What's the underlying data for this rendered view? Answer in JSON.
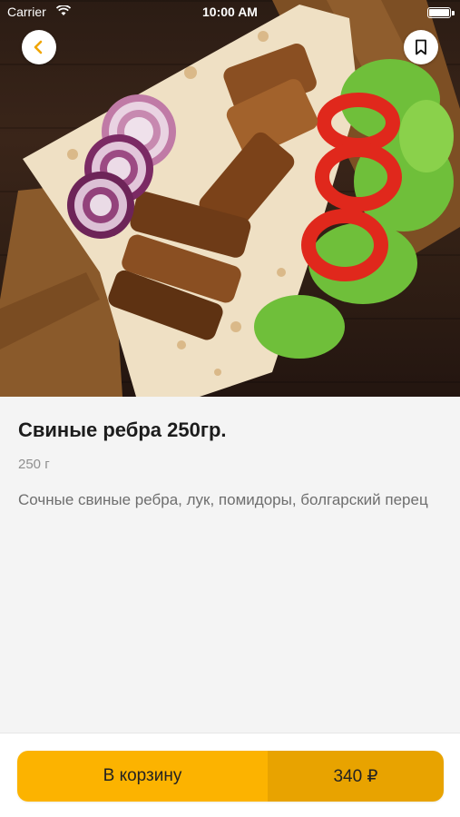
{
  "status_bar": {
    "carrier": "Carrier",
    "time": "10:00 AM"
  },
  "header": {
    "back_icon": "chevron-left-icon",
    "bookmark_icon": "bookmark-icon"
  },
  "product": {
    "title": "Свиные ребра 250гр.",
    "weight": "250 г",
    "description": "Сочные свиные ребра, лук, помидоры, болгарский перец"
  },
  "cart": {
    "label": "В корзину",
    "price": "340 ₽"
  },
  "colors": {
    "accent": "#fcb300",
    "accent_dark": "#e8a300",
    "back_icon": "#f0a500"
  }
}
